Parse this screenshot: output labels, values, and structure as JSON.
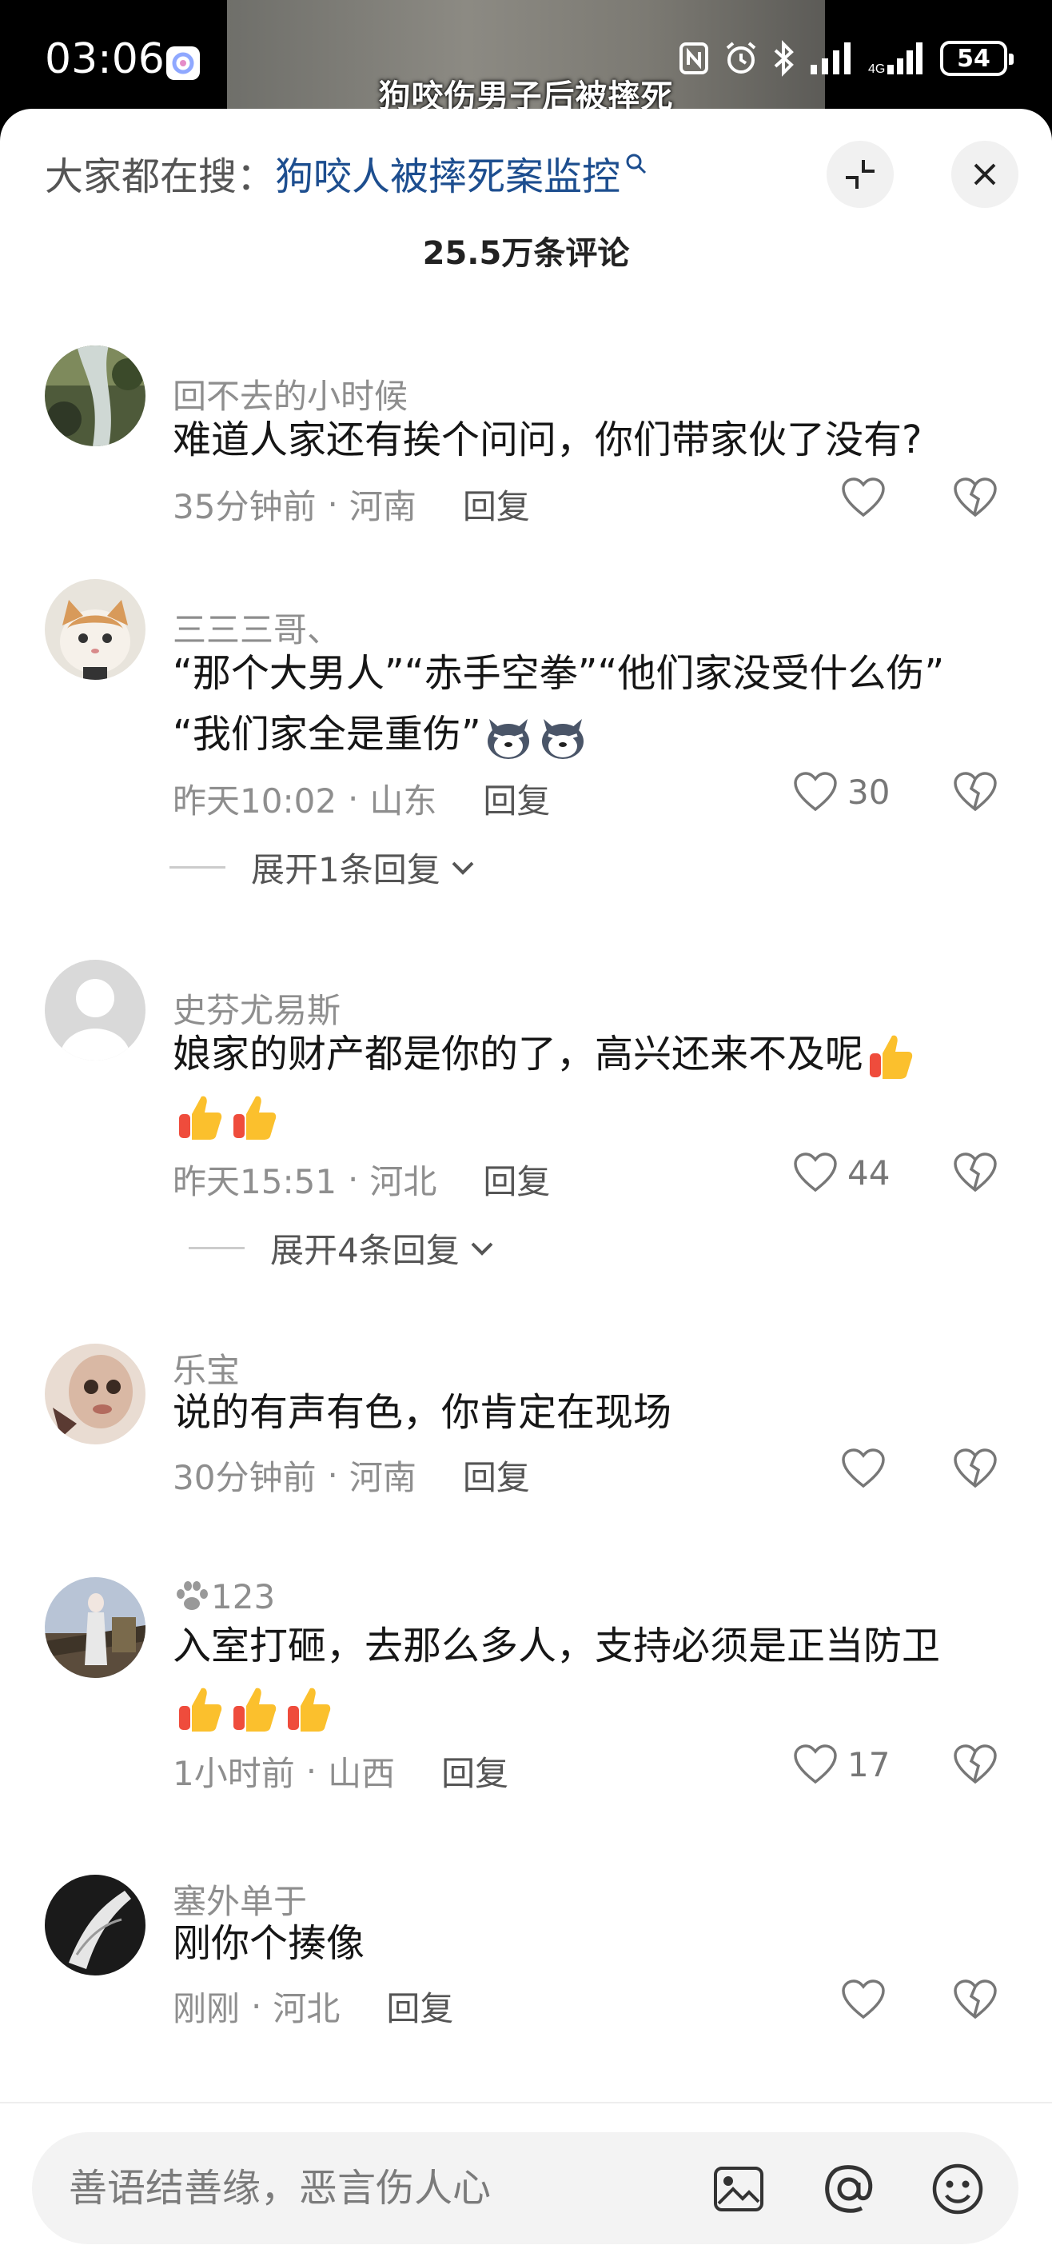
{
  "status_bar": {
    "time": "03:06",
    "battery": "54",
    "video_caption": "狗咬伤男子后被摔死"
  },
  "header": {
    "search_prefix": "大家都在搜：",
    "search_term": "狗咬人被摔死案监控",
    "comment_count": "25.5万条评论"
  },
  "comments": [
    {
      "user": "回不去的小时候",
      "text": "难道人家还有挨个问问，你们带家伙了没有?",
      "time": "35分钟前",
      "location": "河南",
      "reply": "回复",
      "likes": ""
    },
    {
      "user": "三三三哥、",
      "text_line1": "“那个大男人”“赤手空拳”“他们家没受什么伤”",
      "text_line2": "“我们家全是重伤”",
      "emojis": [
        "husky-face",
        "husky-face"
      ],
      "time": "昨天10:02",
      "location": "山东",
      "reply": "回复",
      "likes": "30",
      "expand": "展开1条回复"
    },
    {
      "user": "史芬尤易斯",
      "text": "娘家的财产都是你的了，高兴还来不及呢",
      "emojis": [
        "thumbs-up",
        "thumbs-up",
        "thumbs-up"
      ],
      "time": "昨天15:51",
      "location": "河北",
      "reply": "回复",
      "likes": "44",
      "expand": "展开4条回复"
    },
    {
      "user": "乐宝",
      "text": "说的有声有色，你肯定在现场",
      "time": "30分钟前",
      "location": "河南",
      "reply": "回复",
      "likes": ""
    },
    {
      "user": "123",
      "text": "入室打砸，去那么多人，支持必须是正当防卫",
      "emojis": [
        "thumbs-up",
        "thumbs-up",
        "thumbs-up"
      ],
      "time": "1小时前",
      "location": "山西",
      "reply": "回复",
      "likes": "17"
    },
    {
      "user": "塞外单于",
      "text": "刚你个揍像",
      "time": "刚刚",
      "location": "河北",
      "reply": "回复",
      "likes": ""
    }
  ],
  "input": {
    "placeholder": "善语结善缘，恶言伤人心"
  },
  "colors": {
    "search_term": "#1d4e8f",
    "meta_gray": "#8e8e8e",
    "text": "#161616"
  }
}
